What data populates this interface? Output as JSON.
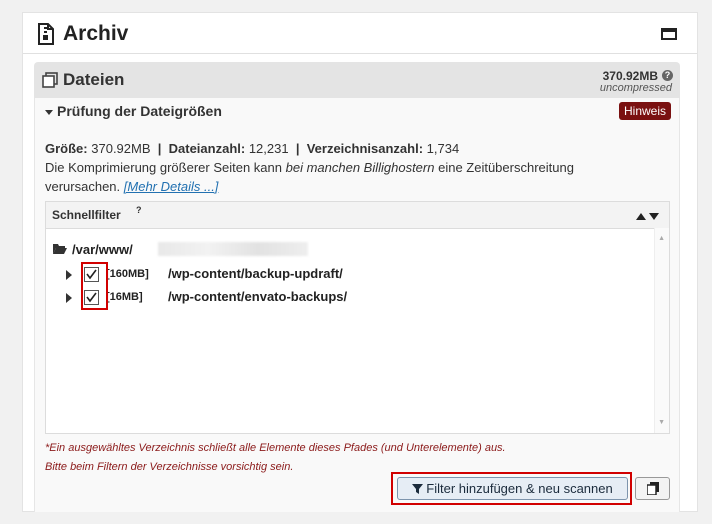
{
  "header": {
    "title": "Archiv"
  },
  "section": {
    "title": "Dateien",
    "size": "370.92MB",
    "size_note": "uncompressed"
  },
  "check": {
    "title": "Prüfung der Dateigrößen",
    "hint": "Hinweis",
    "stats": {
      "size_label": "Größe:",
      "size_value": "370.92MB",
      "files_label": "Dateianzahl:",
      "files_value": "12,231",
      "dirs_label": "Verzeichnisanzahl:",
      "dirs_value": "1,734",
      "sep": "|"
    },
    "desc_prefix": "Die Komprimierung größerer Seiten kann ",
    "desc_italic": "bei manchen Billighostern",
    "desc_suffix": " eine Zeitüberschreitung verursachen.",
    "details_link": "[Mehr Details ...]"
  },
  "filter": {
    "title": "Schnellfilter",
    "root": "/var/www/",
    "rows": [
      {
        "size": "[160MB]",
        "path": "/wp-content/backup-updraft/",
        "checked": true
      },
      {
        "size": "[16MB]",
        "path": "/wp-content/envato-backups/",
        "checked": true
      }
    ]
  },
  "warnings": [
    "*Ein ausgewähltes Verzeichnis schließt alle Elemente dieses Pfades (und Unterelemente) aus.",
    "Bitte beim Filtern der Verzeichnisse vorsichtig sein."
  ],
  "buttons": {
    "scan": "Filter hinzufügen & neu scannen"
  },
  "colors": {
    "hint_badge": "#7a1111",
    "warning_text": "#8b1a1a",
    "highlight": "#d10000",
    "link": "#2271b1"
  }
}
